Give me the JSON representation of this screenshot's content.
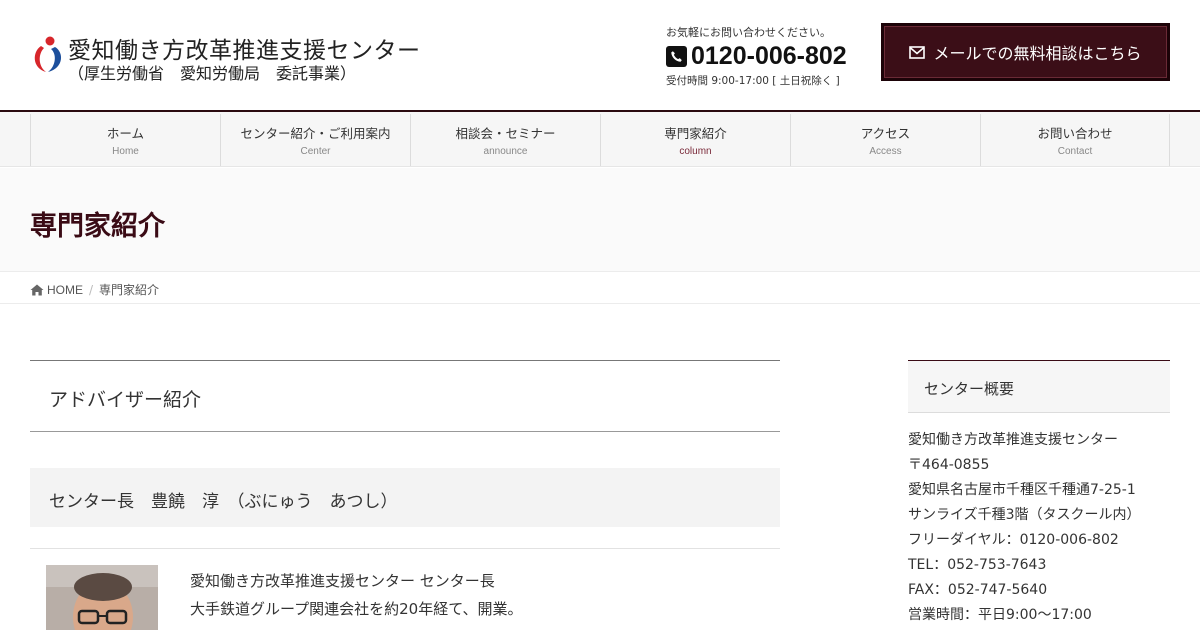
{
  "header": {
    "title": "愛知働き方改革推進支援センター",
    "subtitle": "（厚生労働省　愛知労働局　委託事業）",
    "contact_lead": "お気軽にお問い合わせください。",
    "phone": "0120-006-802",
    "hours": "受付時間 9:00-17:00 [ 土日祝除く ]",
    "mail_button": "メールでの無料相談はこちら",
    "colors": {
      "accent": "#3b0e17",
      "logo_red": "#d7262b",
      "logo_blue": "#1d4f9c"
    }
  },
  "nav": {
    "items": [
      {
        "label": "ホーム",
        "sub": "Home"
      },
      {
        "label": "センター紹介・ご利用案内",
        "sub": "Center"
      },
      {
        "label": "相談会・セミナー",
        "sub": "announce"
      },
      {
        "label": "専門家紹介",
        "sub": "column"
      },
      {
        "label": "アクセス",
        "sub": "Access"
      },
      {
        "label": "お問い合わせ",
        "sub": "Contact"
      }
    ]
  },
  "page": {
    "title": "専門家紹介",
    "breadcrumb": {
      "home": "HOME",
      "current": "専門家紹介"
    }
  },
  "main": {
    "section_title": "アドバイザー紹介",
    "person_heading": "センター長　豊饒　淳　（ぶにゅう　あつし）",
    "bio": [
      "愛知働き方改革推進支援センター センター長",
      "大手鉄道グループ関連会社を約20年経て、開業。"
    ]
  },
  "sidebar": {
    "title": "センター概要",
    "lines": [
      "愛知働き方改革推進支援センター",
      "〒464-0855",
      "愛知県名古屋市千種区千種通7-25-1",
      "サンライズ千種3階（タスクール内）",
      "フリーダイヤル：0120-006-802",
      "TEL：052-753-7643",
      "FAX：052-747-5640",
      "営業時間：平日9:00～17:00"
    ]
  }
}
